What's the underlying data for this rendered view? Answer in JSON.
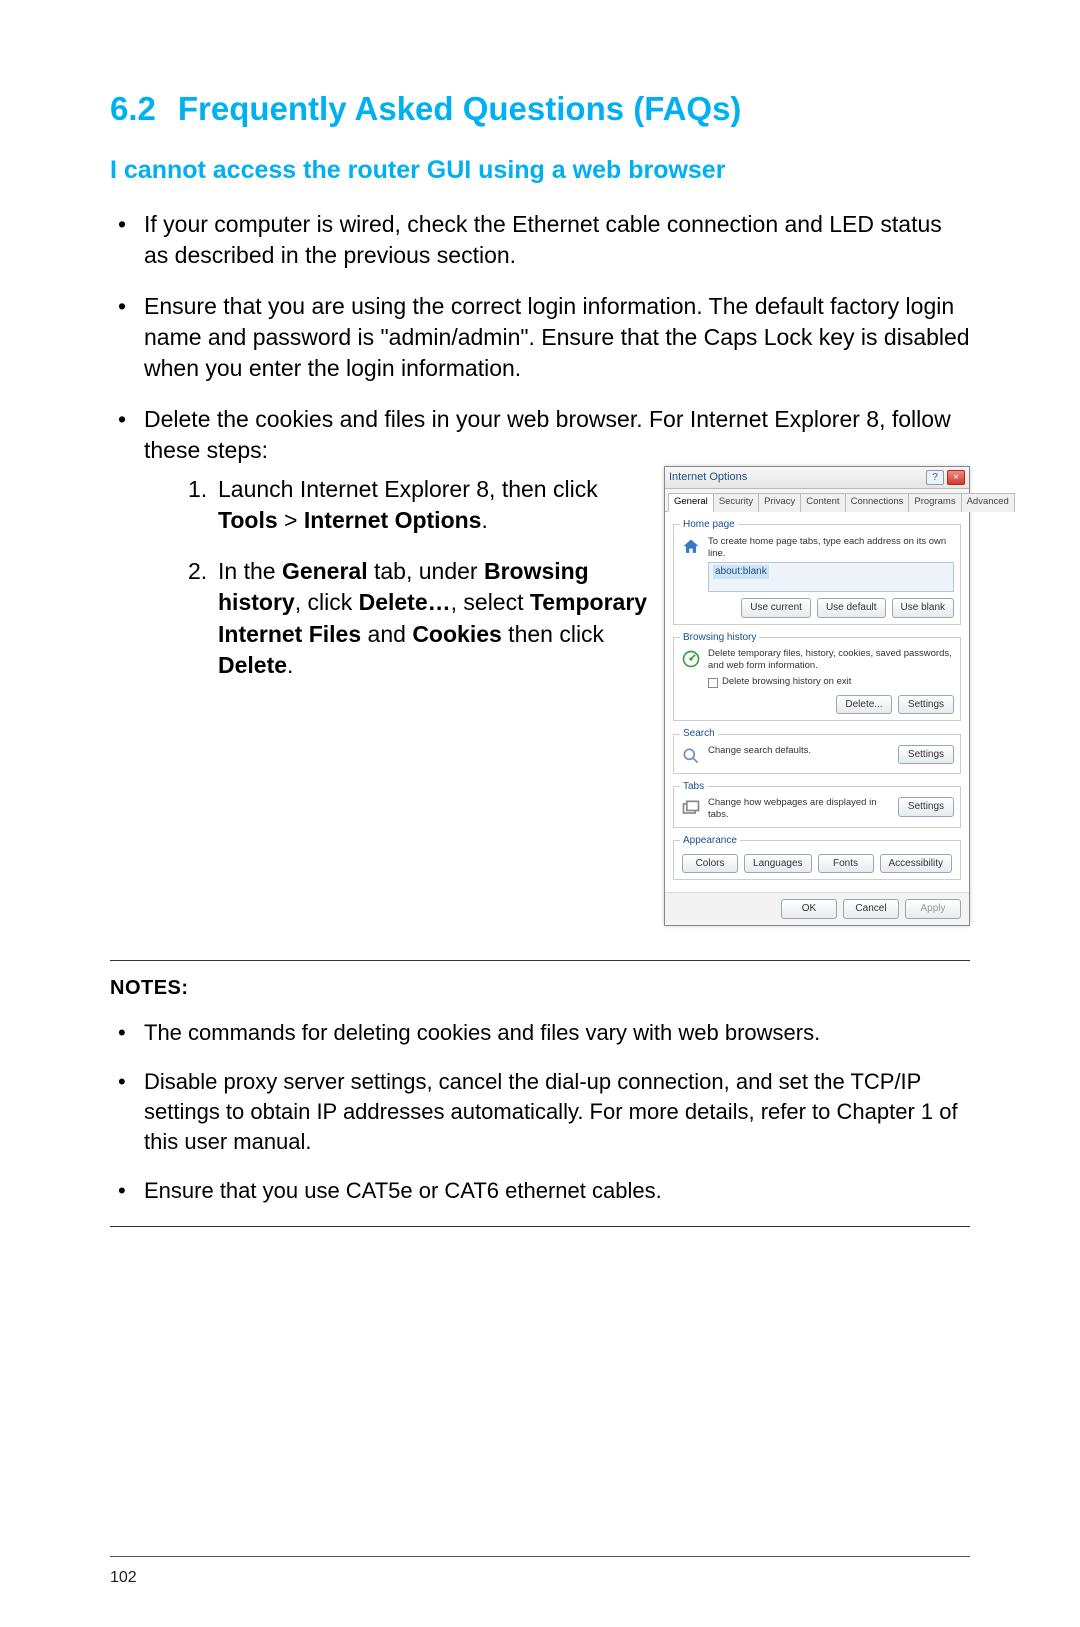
{
  "heading": {
    "num": "6.2",
    "title": "Frequently Asked Questions (FAQs)"
  },
  "subheading": "I cannot access the router GUI using a web browser",
  "bullets": [
    "If your computer is wired, check the Ethernet cable connection and LED status as described in the previous section.",
    "Ensure that you are using the correct login information. The default factory login name and password is \"admin/admin\". Ensure that the Caps Lock key is disabled when you enter the login information.",
    "Delete the cookies and files in your web browser. For Internet Explorer 8, follow these steps:"
  ],
  "steps": {
    "s1": {
      "num": "1.",
      "a": "Launch Internet Explorer 8, then click ",
      "b1": "Tools",
      "gt": " > ",
      "b2": "Internet Options",
      "end": "."
    },
    "s2": {
      "num": "2.",
      "a": "In the ",
      "b1": "General",
      "b": " tab, under ",
      "b2": "Browsing history",
      "c": ", click ",
      "b3": "Delete…",
      "d": ", select ",
      "b4": "Temporary Internet Files",
      "e": " and ",
      "b5": "Cookies",
      "f": " then click ",
      "b6": "Delete",
      "end": "."
    }
  },
  "dialog": {
    "title": "Internet Options",
    "help": "?",
    "close": "×",
    "tabs": [
      "General",
      "Security",
      "Privacy",
      "Content",
      "Connections",
      "Programs",
      "Advanced"
    ],
    "home": {
      "legend": "Home page",
      "desc": "To create home page tabs, type each address on its own line.",
      "addr": "about:blank",
      "b1": "Use current",
      "b2": "Use default",
      "b3": "Use blank"
    },
    "hist": {
      "legend": "Browsing history",
      "desc": "Delete temporary files, history, cookies, saved passwords, and web form information.",
      "chk": "Delete browsing history on exit",
      "b1": "Delete...",
      "b2": "Settings"
    },
    "search": {
      "legend": "Search",
      "desc": "Change search defaults.",
      "b1": "Settings"
    },
    "tabsGrp": {
      "legend": "Tabs",
      "desc": "Change how webpages are displayed in tabs.",
      "b1": "Settings"
    },
    "appear": {
      "legend": "Appearance",
      "b1": "Colors",
      "b2": "Languages",
      "b3": "Fonts",
      "b4": "Accessibility"
    },
    "footer": {
      "ok": "OK",
      "cancel": "Cancel",
      "apply": "Apply"
    }
  },
  "notes": {
    "heading": "NOTES:",
    "items": [
      "The commands for deleting cookies and files vary with web browsers.",
      "Disable proxy server settings, cancel the dial-up connection, and set the TCP/IP settings to obtain IP addresses automatically. For more details, refer to Chapter 1 of this user manual.",
      "Ensure that you use CAT5e or CAT6 ethernet cables."
    ]
  },
  "pageNumber": "102"
}
